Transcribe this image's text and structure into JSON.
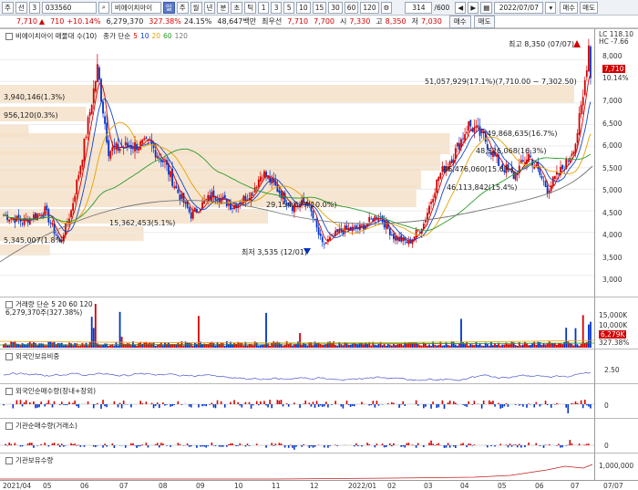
{
  "toolbar": {
    "buttons": [
      "주",
      "선",
      "3"
    ],
    "code": "033560",
    "name": "비에이치아이",
    "periods": [
      "주",
      "월",
      "년",
      "분",
      "초",
      "틱"
    ],
    "intervals": [
      "1",
      "3",
      "5",
      "10",
      "15",
      "30",
      "60",
      "120"
    ],
    "count": "314",
    "total": "600",
    "date": "2022/07/07",
    "sell_label": "매수",
    "buy_label": "매도"
  },
  "info": {
    "price": "7,710",
    "change": "710",
    "change_pct": "+10.14%",
    "volume": "6,279,370",
    "vol_ratio": "327.38%",
    "turnover": "24.15%",
    "amount": "48,647백만",
    "pref_label": "최우선",
    "ask": "7,710",
    "bid": "7,700",
    "open_label": "시",
    "open": "7,330",
    "high_label": "고",
    "high": "8,350",
    "low_label": "저",
    "low": "7,030"
  },
  "price_panel": {
    "title": "비에이치아이 매물대 수(10)",
    "ma_label": "종가 단순",
    "ma_periods": [
      "5",
      "10",
      "20",
      "60",
      "120"
    ],
    "ma_colors": [
      "#d40000",
      "#1144cc",
      "#e6a000",
      "#2a9a2a",
      "#777777"
    ],
    "hi_annot": "최고 8,350 (07/07)",
    "lo_annot": "최저 3,535 (12/01)",
    "lc": "LC 118.10",
    "hc": "HC -7.66",
    "price_tag": "7,710",
    "pct_tag": "10.14%",
    "profile": [
      {
        "label": "51,057,929(17.1%)(7,710.00 ~ 7,302.50)"
      },
      {
        "label": "3,940,146(1.3%)"
      },
      {
        "label": "956,120(0.3%)"
      },
      {
        "label": "49,868,635(16.7%)"
      },
      {
        "label": "48,526,068(16.3%)"
      },
      {
        "label": "46,476,060(15.6%)"
      },
      {
        "label": "46,113,842(15.4%)"
      },
      {
        "label": "29,154,677(10.0%)"
      },
      {
        "label": "15,362,453(5.1%)"
      },
      {
        "label": "5,345,007(1.8%)"
      }
    ],
    "ticks": [
      "8,000",
      "7,500",
      "7,000",
      "6,500",
      "6,000",
      "5,500",
      "5,000",
      "4,500",
      "4,000",
      "3,500",
      "3,000"
    ]
  },
  "volume_panel": {
    "title": "거래량 단순 5 20 60 120",
    "value": "6,279,370주(327.38%)",
    "ticks": [
      "15,000K",
      "10,000K",
      "5,000K"
    ],
    "tag": "6,279K",
    "tag2": "327.38%"
  },
  "foreign_ratio_panel": {
    "title": "외국인보유비중",
    "ticks": [
      "2.50"
    ]
  },
  "foreign_net_panel": {
    "title": "외국인순매수량(장내+장외)",
    "ticks": [
      "0"
    ]
  },
  "inst_net_panel": {
    "title": "기관순매수량(거래소)",
    "ticks": [
      "0"
    ]
  },
  "inst_hold_panel": {
    "title": "기관보유수량",
    "ticks": [
      "1,000,000"
    ]
  },
  "x_axis": [
    "2021/04",
    "05",
    "06",
    "07",
    "08",
    "09",
    "10",
    "11",
    "12",
    "2022/01",
    "02",
    "03",
    "04",
    "05",
    "06",
    "07",
    "07/07"
  ],
  "colors": {
    "up": "#d40000",
    "down": "#0033cc",
    "profile": "#f5e0c8"
  }
}
